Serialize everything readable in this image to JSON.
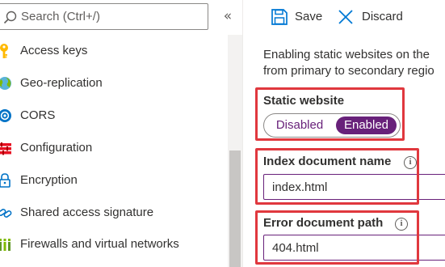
{
  "sidebar": {
    "search": {
      "placeholder": "Search (Ctrl+/)",
      "value": ""
    },
    "collapse_glyph": "«",
    "items": [
      {
        "label": "Access keys",
        "icon": "key-icon"
      },
      {
        "label": "Geo-replication",
        "icon": "globe-icon"
      },
      {
        "label": "CORS",
        "icon": "cors-icon"
      },
      {
        "label": "Configuration",
        "icon": "configuration-icon"
      },
      {
        "label": "Encryption",
        "icon": "lock-icon"
      },
      {
        "label": "Shared access signature",
        "icon": "link-chain-icon"
      },
      {
        "label": "Firewalls and virtual networks",
        "icon": "firewall-icon"
      }
    ]
  },
  "toolbar": {
    "save_label": "Save",
    "discard_label": "Discard"
  },
  "main": {
    "description_lines": [
      "Enabling static websites on the",
      "from primary to secondary regio"
    ],
    "static_website": {
      "label": "Static website",
      "options": [
        "Disabled",
        "Enabled"
      ],
      "selected": "Enabled"
    },
    "index_document": {
      "label": "Index document name",
      "value": "index.html"
    },
    "error_document": {
      "label": "Error document path",
      "value": "404.html"
    }
  },
  "colors": {
    "accent": "#68217a",
    "highlight": "#e0383e",
    "save_icon": "#0078d4"
  }
}
